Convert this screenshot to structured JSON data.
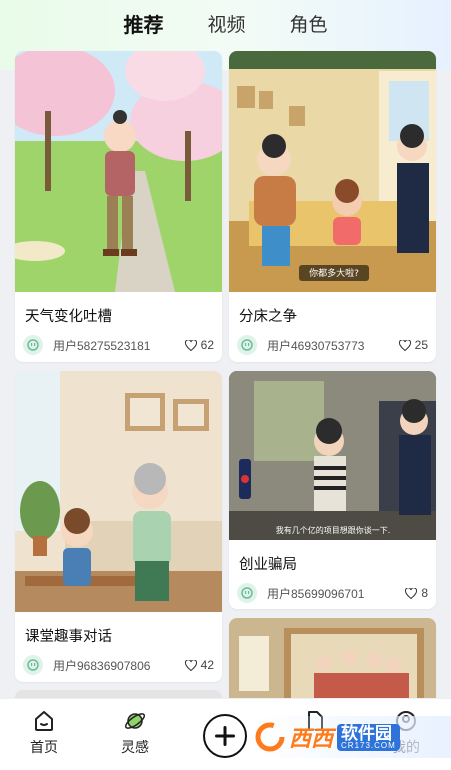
{
  "tabs": [
    {
      "label": "推荐",
      "active": true
    },
    {
      "label": "视频",
      "active": false
    },
    {
      "label": "角色",
      "active": false
    }
  ],
  "cards": [
    {
      "title": "天气变化吐槽",
      "user": "用户58275523181",
      "likes": "62"
    },
    {
      "title": "分床之争",
      "user": "用户46930753773",
      "likes": "25",
      "subtitle": "你都多大啦?"
    },
    {
      "title": "课堂趣事对话",
      "user": "用户96836907806",
      "likes": "42"
    },
    {
      "title": "创业骗局",
      "user": "用户85699096701",
      "likes": "8",
      "subtitle": "我有几个亿的项目想跟你谈一下."
    }
  ],
  "bottom_nav": [
    {
      "label": "首页",
      "icon": "home-icon"
    },
    {
      "label": "灵感",
      "icon": "planet-icon"
    },
    {
      "label": "",
      "icon": "plus-icon"
    },
    {
      "label": "",
      "icon": "document-icon"
    },
    {
      "label": "我的",
      "icon": "profile-icon"
    }
  ],
  "watermark": {
    "main": "西西",
    "brand": "软件园",
    "domain": "CR173.COM"
  },
  "colors": {
    "accent_green": "#9ef06b",
    "background": "#eef0f4"
  }
}
